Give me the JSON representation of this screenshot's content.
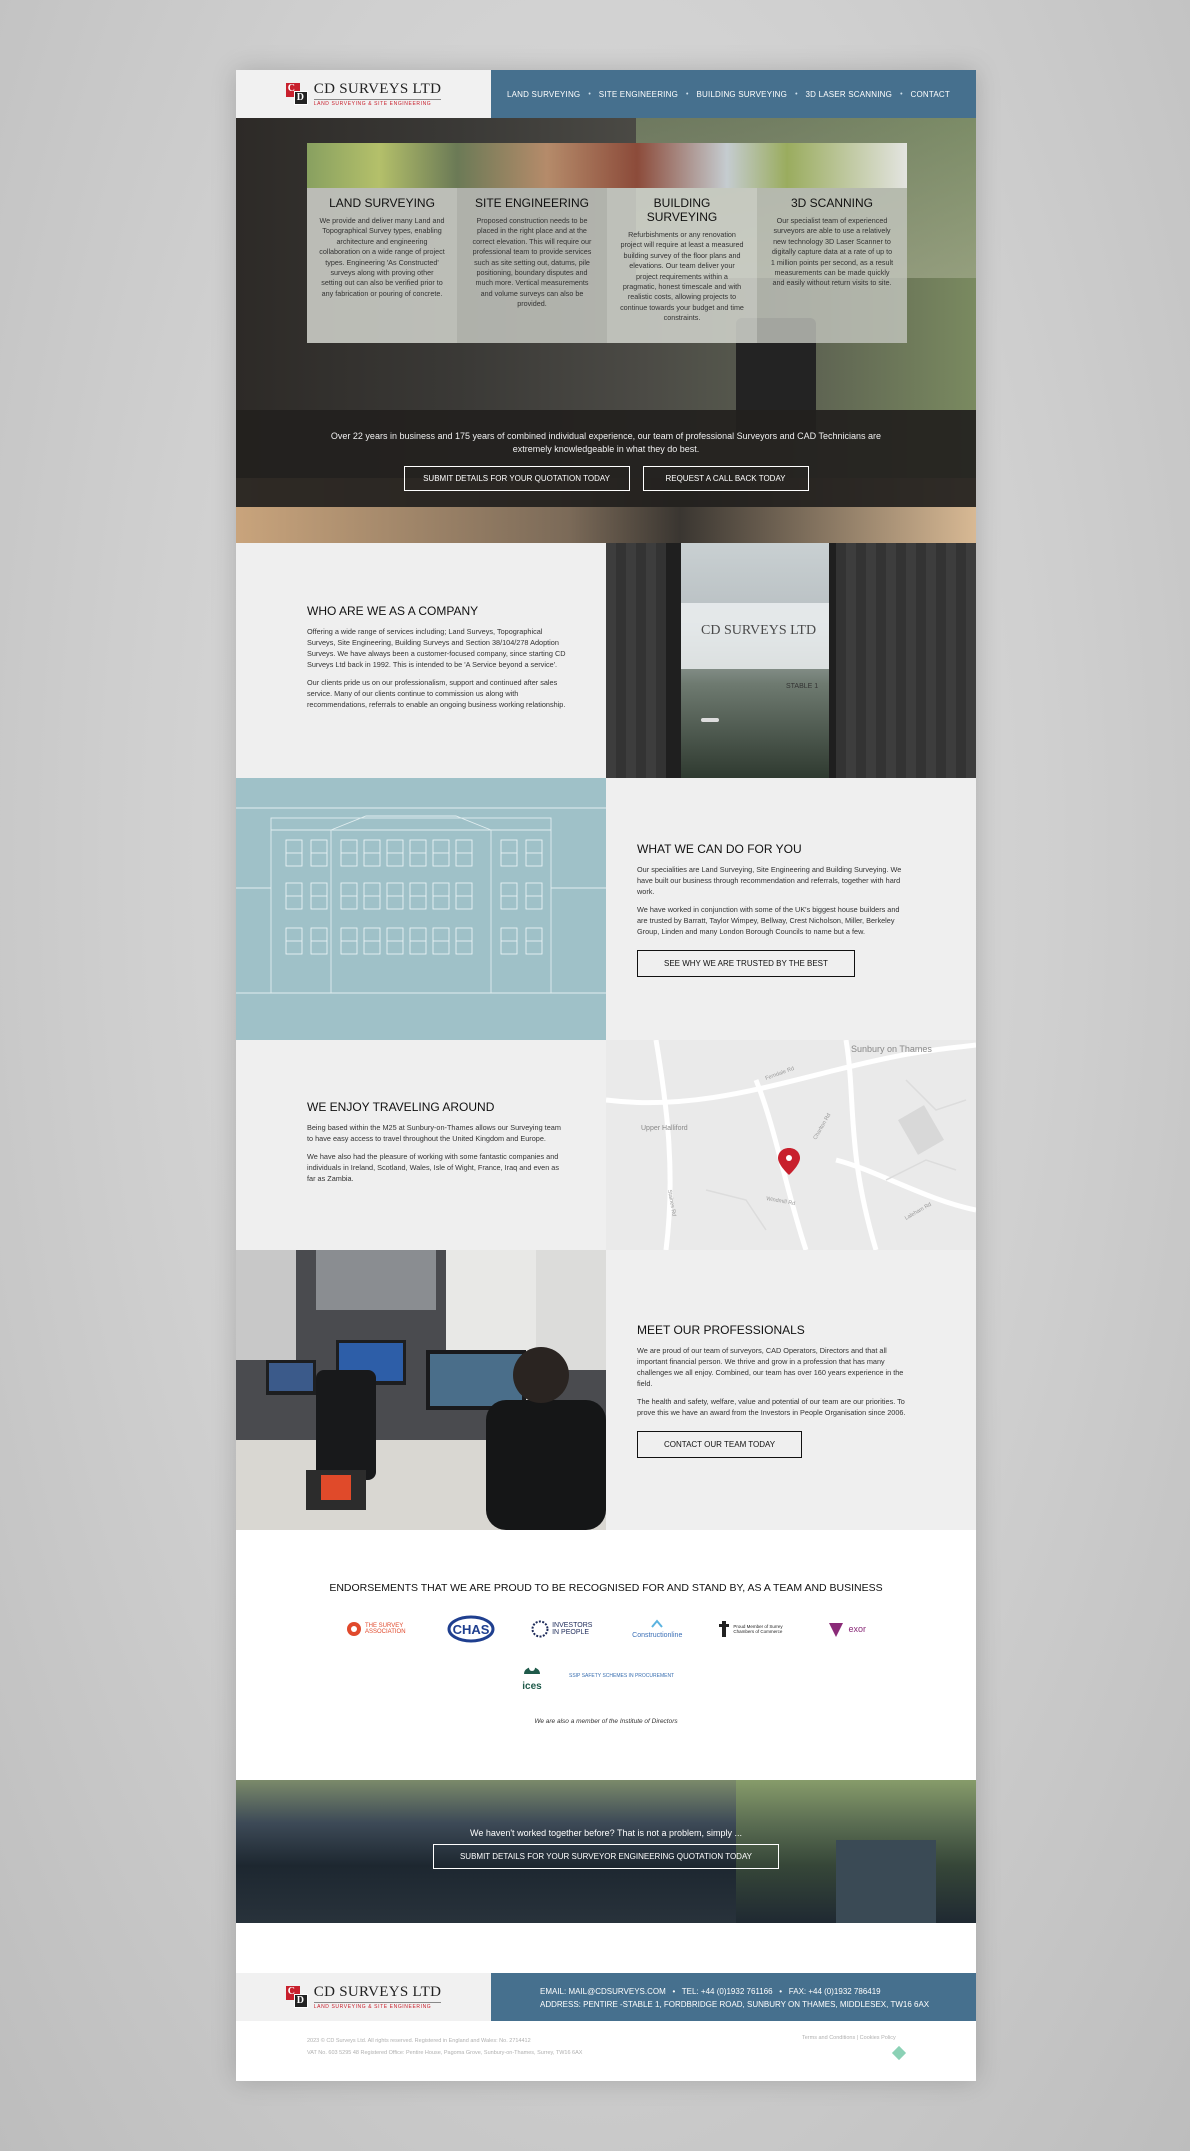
{
  "brand": {
    "name": "CD SURVEYS LTD",
    "tagline": "LAND SURVEYING & SITE ENGINEERING",
    "mark_letter_1": "C",
    "mark_letter_2": "D",
    "colors": {
      "nav_blue": "#46708e",
      "mark_red": "#c8202d",
      "mark_dark": "#222222"
    }
  },
  "nav": {
    "items": [
      "LAND SURVEYING",
      "SITE ENGINEERING",
      "BUILDING SURVEYING",
      "3D LASER SCANNING",
      "CONTACT"
    ]
  },
  "hero": {
    "services": [
      {
        "title": "LAND SURVEYING",
        "text": "We provide and deliver many Land and Topographical Survey types, enabling architecture and engineering collaboration on a wide range of project types. Engineering 'As Constructed' surveys along with proving other setting out can also be verified prior to any fabrication or pouring of concrete."
      },
      {
        "title": "SITE ENGINEERING",
        "text": "Proposed construction needs to be placed in the right place and at the correct elevation. This will require our professional team to provide services such as site setting out, datums, pile positioning, boundary disputes and much more. Vertical measurements and volume surveys can also be provided."
      },
      {
        "title": "BUILDING SURVEYING",
        "text": "Refurbishments or any renovation project will require at least a measured building survey of the floor plans and elevations. Our team deliver your project requirements within a pragmatic, honest timescale and with realistic costs, allowing projects to continue towards your budget and time constraints."
      },
      {
        "title": "3D SCANNING",
        "text": "Our specialist team of experienced surveyors are able to use a relatively new technology 3D Laser Scanner to digitally capture data at a rate of up to 1 million points per second, as a result measurements can be made quickly and easily without return visits to site."
      }
    ],
    "lead": "Over 22 years in business and 175 years of combined individual experience, our team of professional Surveyors and CAD Technicians are extremely knowledgeable in what they do best.",
    "btn_quote": "SUBMIT DETAILS FOR YOUR QUOTATION TODAY",
    "btn_callback": "REQUEST A CALL BACK TODAY"
  },
  "who": {
    "title": "WHO ARE WE AS A COMPANY",
    "p1": "Offering a wide range of services including; Land Surveys, Topographical Surveys, Site Engineering, Building Surveys and Section 38/104/278 Adoption Surveys. We have always been a customer-focused company, since starting CD Surveys Ltd back in 1992. This is intended to be 'A Service beyond a service'.",
    "p2": "Our clients pride us on our professionalism, support and continued after sales service. Many of our clients continue to commission us along with recommendations, referrals to enable an ongoing business working relationship.",
    "door_sign": "CD SURVEYS LTD",
    "door_label": "STABLE 1"
  },
  "what": {
    "title": "WHAT WE CAN DO FOR YOU",
    "p1": "Our specialities are Land Surveying, Site Engineering and Building Surveying. We have built our business through recommendation and referrals, together with hard work.",
    "p2": "We have worked in conjunction with some of the UK's biggest house builders and are trusted by Barratt, Taylor Wimpey, Bellway, Crest Nicholson, Miller, Berkeley Group, Linden and many London Borough Councils to name but a few.",
    "btn": "SEE WHY WE ARE TRUSTED BY THE BEST"
  },
  "travel": {
    "title": "WE ENJOY TRAVELING AROUND",
    "p1": "Being based within the M25 at Sunbury-on-Thames allows our Surveying team to have easy access to travel throughout the United Kingdom and Europe.",
    "p2": "We have also had the pleasure of working with some fantastic companies and individuals in Ireland, Scotland, Wales, Isle of Wight, France, Iraq and even as far as Zambia.",
    "map_labels": [
      "Sunbury on Thames",
      "Upper Halliford",
      "Ferndale Rd",
      "Charlton Rd",
      "Laleham Rd",
      "Staines Rd",
      "Windmill Rd"
    ]
  },
  "team": {
    "title": "MEET OUR PROFESSIONALS",
    "p1": "We are proud of our team of surveyors, CAD Operators, Directors and that all important financial person. We thrive and grow in a profession that has many challenges we all enjoy. Combined, our team has over 160 years experience in the field.",
    "p2": "The health and safety, welfare, value and potential of our team are our priorities. To prove this we have an award from the Investors in People Organisation since 2006.",
    "btn": "CONTACT OUR TEAM TODAY"
  },
  "endorsements": {
    "title": "ENDORSEMENTS THAT WE ARE PROUD TO BE RECOGNISED FOR AND STAND BY, AS A TEAM AND BUSINESS",
    "logos": [
      {
        "name": "THE SURVEY ASSOCIATION",
        "icon": "tsa-logo",
        "color": "#e0492c"
      },
      {
        "name": "CHAS",
        "icon": "chas-logo",
        "color": "#1f3f8f"
      },
      {
        "name": "INVESTORS IN PEOPLE",
        "icon": "iip-logo",
        "color": "#1e2b5a"
      },
      {
        "name": "Constructionline",
        "icon": "constructionline-logo",
        "color": "#3b6fb6"
      },
      {
        "name": "Proud Member of Surrey Chambers of Commerce",
        "icon": "surrey-chambers-logo",
        "color": "#222222"
      },
      {
        "name": "exor",
        "icon": "exor-logo",
        "color": "#8a2a78"
      },
      {
        "name": "ices",
        "icon": "ices-logo",
        "color": "#1f5a4a"
      },
      {
        "name": "SSIP SAFETY SCHEMES IN PROCUREMENT",
        "icon": "ssip-logo",
        "color": "#3a6fb0"
      }
    ],
    "note": "We are also a member of the Institute of Directors"
  },
  "cta": {
    "question": "We haven't worked together before? That is not a problem, simply ...",
    "btn": "SUBMIT DETAILS FOR YOUR SURVEYOR ENGINEERING QUOTATION TODAY"
  },
  "footer": {
    "email": "EMAIL: MAIL@CDSURVEYS.COM",
    "tel": "TEL: +44 (0)1932 761166",
    "fax": "FAX: +44 (0)1932 786419",
    "address": "ADDRESS: PENTIRE -STABLE 1, FORDBRIDGE ROAD, SUNBURY ON THAMES, MIDDLESEX, TW16 6AX",
    "legal1": "2023 © CD Surveys Ltd. All rights reserved.   Registered in England and Wales: No. 2714412",
    "legal2": "VAT No. 603 5295 48    Registered Office: Pentire House, Pagoma Grove, Sunbury-on-Thames, Surrey, TW16 6AX",
    "terms": "Terms and Conditions  |  Cookies Policy"
  }
}
